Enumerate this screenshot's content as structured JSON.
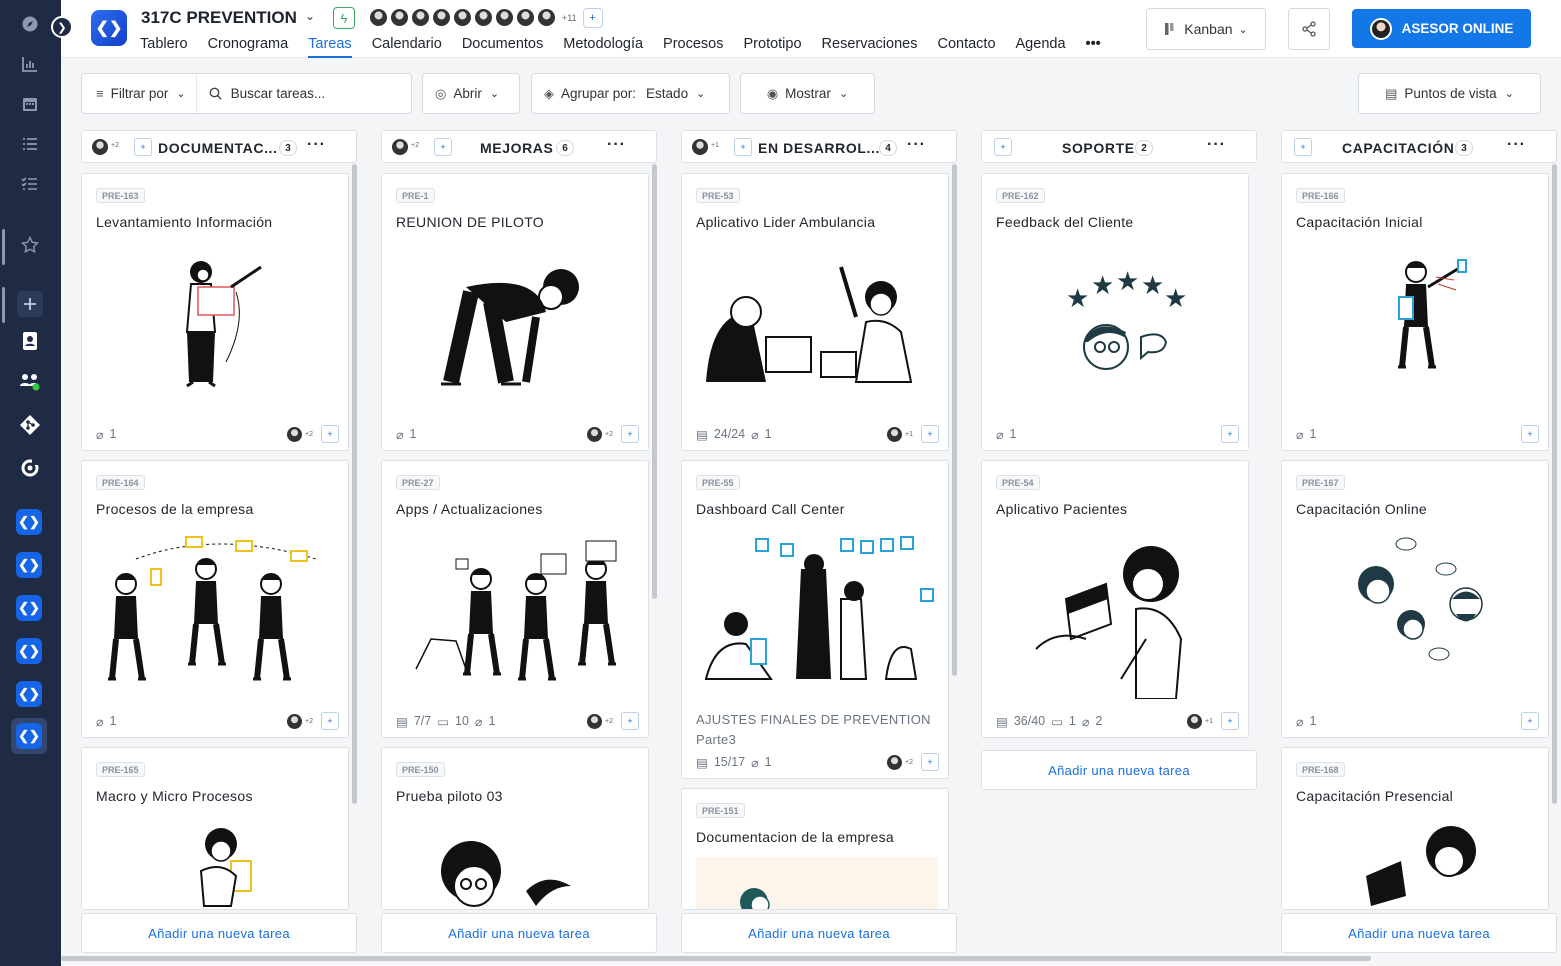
{
  "app": {
    "project_title": "317C PREVENTION",
    "avatars_more": "+11",
    "nav": [
      "Tablero",
      "Cronograma",
      "Tareas",
      "Calendario",
      "Documentos",
      "Metodología",
      "Procesos",
      "Prototipo",
      "Reservaciones",
      "Contacto",
      "Agenda"
    ],
    "nav_active": "Tareas",
    "view_label": "Kanban",
    "advisor_label": "ASESOR ONLINE"
  },
  "toolbar": {
    "filter_label": "Filtrar por",
    "search_placeholder": "Buscar tareas...",
    "open_label": "Abrir",
    "group_label": "Agrupar por:",
    "group_value": "Estado",
    "show_label": "Mostrar",
    "viewpoints_label": "Puntos de vista"
  },
  "add_task_label": "Añadir una nueva tarea",
  "columns": [
    {
      "title": "DOCUMENTAC...",
      "count": "3",
      "head_more": "+2",
      "cards": [
        {
          "id": "PRE-163",
          "title": "Levantamiento Información",
          "meta": [
            "1"
          ],
          "more": "+2"
        },
        {
          "id": "PRE-164",
          "title": "Procesos de la empresa",
          "meta": [
            "1"
          ],
          "more": "+2"
        },
        {
          "id": "PRE-165",
          "title": "Macro y Micro Procesos"
        }
      ]
    },
    {
      "title": "MEJORAS",
      "count": "6",
      "head_more": "+2",
      "cards": [
        {
          "id": "PRE-1",
          "title": "REUNION DE PILOTO",
          "meta": [
            "1"
          ],
          "more": "+2"
        },
        {
          "id": "PRE-27",
          "title": "Apps / Actualizaciones",
          "meta": [
            "7/7",
            "10",
            "1"
          ],
          "more": "+2"
        },
        {
          "id": "PRE-150",
          "title": "Prueba piloto 03"
        }
      ]
    },
    {
      "title": "EN DESARROL...",
      "count": "4",
      "head_more": "+1",
      "cards": [
        {
          "id": "PRE-53",
          "title": "Aplicativo Lider Ambulancia",
          "meta": [
            "24/24",
            "1"
          ],
          "more": "+1"
        },
        {
          "id": "PRE-55",
          "title": "Dashboard Call Center",
          "subtitle": "AJUSTES FINALES DE PREVENTION",
          "subtitle2": "Parte3",
          "meta": [
            "15/17",
            "1"
          ],
          "more": "+2"
        },
        {
          "id": "PRE-151",
          "title": "Documentacion de la empresa"
        }
      ]
    },
    {
      "title": "SOPORTE",
      "count": "2",
      "cards": [
        {
          "id": "PRE-162",
          "title": "Feedback del Cliente",
          "meta": [
            "1"
          ]
        },
        {
          "id": "PRE-54",
          "title": "Aplicativo Pacientes",
          "meta": [
            "36/40",
            "1",
            "2"
          ],
          "more": "+1"
        }
      ]
    },
    {
      "title": "CAPACITACIÓN",
      "count": "3",
      "cards": [
        {
          "id": "PRE-166",
          "title": "Capacitación Inicial",
          "meta": [
            "1"
          ]
        },
        {
          "id": "PRE-167",
          "title": "Capacitación Online",
          "meta": [
            "1"
          ]
        },
        {
          "id": "PRE-168",
          "title": "Capacitación Presencial"
        }
      ]
    }
  ]
}
